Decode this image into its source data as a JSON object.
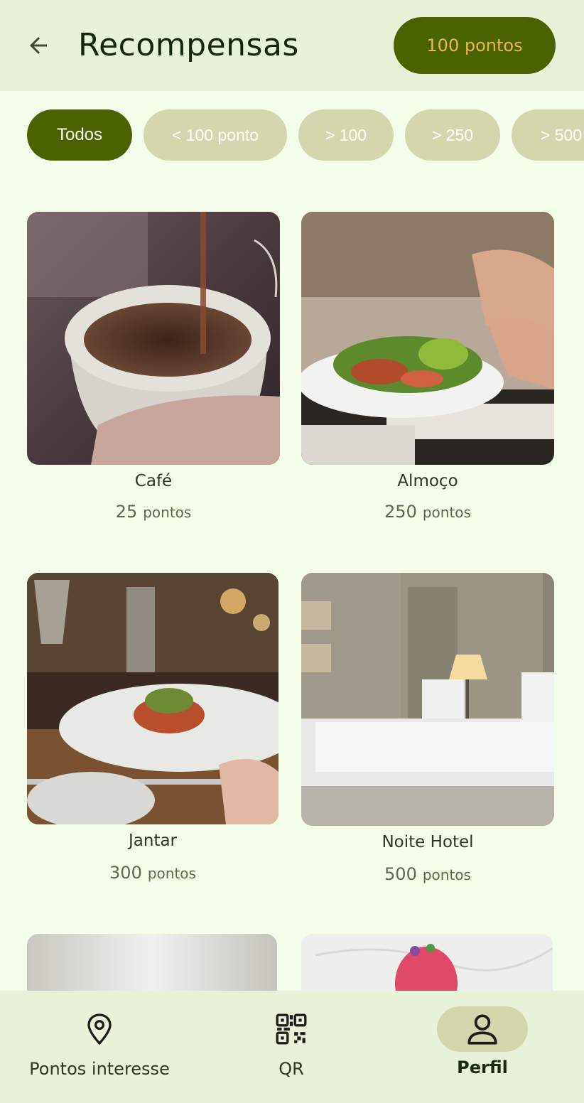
{
  "header": {
    "title": "Recompensas",
    "points_badge": "100 pontos"
  },
  "filters": [
    {
      "label": "Todos",
      "active": true
    },
    {
      "label": "< 100 ponto",
      "active": false
    },
    {
      "label": "> 100",
      "active": false
    },
    {
      "label": "> 250",
      "active": false
    },
    {
      "label": "> 500",
      "active": false
    }
  ],
  "rewards": [
    {
      "name": "Café",
      "points": "25",
      "unit": "pontos"
    },
    {
      "name": "Almoço",
      "points": "250",
      "unit": "pontos"
    },
    {
      "name": "Jantar",
      "points": "300",
      "unit": "pontos"
    },
    {
      "name": "Noite Hotel",
      "points": "500",
      "unit": "pontos"
    }
  ],
  "bottom_nav": [
    {
      "label": "Pontos interesse",
      "icon": "location-pin-icon"
    },
    {
      "label": "QR",
      "icon": "qr-code-icon"
    },
    {
      "label": "Perfil",
      "icon": "person-icon",
      "active": true
    }
  ],
  "colors": {
    "accent": "#4a6300",
    "badge_text": "#e8b84a",
    "chip_inactive": "#d4d6ad",
    "background": "#f4fdea",
    "bar": "#e8f2d8"
  }
}
